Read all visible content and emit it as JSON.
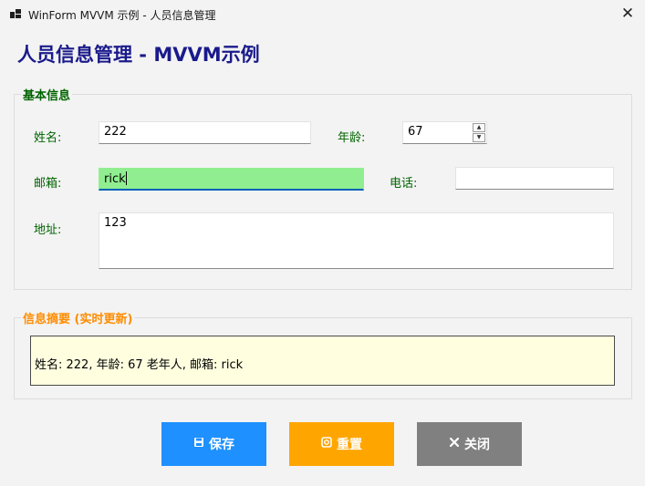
{
  "window": {
    "title": "WinForm MVVM 示例 - 人员信息管理",
    "close_glyph": "✕",
    "icon": "app-window-icon"
  },
  "header": {
    "title": "人员信息管理 - MVVM示例"
  },
  "basic_info": {
    "legend": "基本信息",
    "name_label": "姓名:",
    "name_value": "222",
    "age_label": "年龄:",
    "age_value": "67",
    "email_label": "邮箱:",
    "email_value": "rick",
    "phone_label": "电话:",
    "phone_value": "",
    "address_label": "地址:",
    "address_value": "123"
  },
  "summary": {
    "legend": "信息摘要 (实时更新)",
    "text": "姓名: 222, 年龄: 67 老年人, 邮箱: rick"
  },
  "buttons": {
    "save_label": "保存",
    "save_icon": "save-icon",
    "reset_label": "重置",
    "reset_icon": "reset-icon",
    "close_label": "关闭",
    "close_icon": "close-icon"
  },
  "colors": {
    "heading": "#1a1a8c",
    "label_green": "#006400",
    "legend_orange": "#ff8c00",
    "focused_field": "#90ee90",
    "summary_bg": "#ffffe0",
    "save_btn": "#1e90ff",
    "reset_btn": "#ffa500",
    "close_btn": "#808080"
  }
}
